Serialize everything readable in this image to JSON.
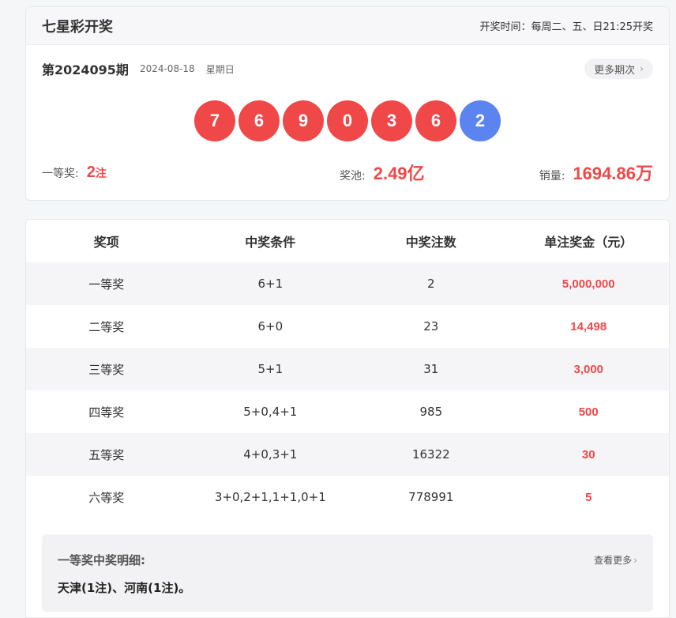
{
  "header": {
    "title": "七星彩开奖",
    "schedule": "开奖时间：每周二、五、日21:25开奖"
  },
  "issue": {
    "number": "第2024095期",
    "date": "2024-08-18",
    "weekday": "星期日",
    "more_label": "更多期次",
    "more_icon": "chevron-right-icon"
  },
  "balls": {
    "red": [
      "7",
      "6",
      "9",
      "0",
      "3",
      "6"
    ],
    "blue": [
      "2"
    ],
    "colors": {
      "red": "#f04848",
      "blue": "#5b84f0"
    }
  },
  "stats": {
    "first_prize_label": "一等奖:",
    "first_prize_count": "2",
    "first_prize_unit": "注",
    "pool_label": "奖池:",
    "pool_value": "2.49",
    "pool_unit": "亿",
    "sales_label": "销量:",
    "sales_value": "1694.86",
    "sales_unit": "万"
  },
  "table": {
    "headers": [
      "奖项",
      "中奖条件",
      "中奖注数",
      "单注奖金（元）"
    ],
    "rows": [
      [
        "一等奖",
        "6+1",
        "2",
        "5,000,000"
      ],
      [
        "二等奖",
        "6+0",
        "23",
        "14,498"
      ],
      [
        "三等奖",
        "5+1",
        "31",
        "3,000"
      ],
      [
        "四等奖",
        "5+0,4+1",
        "985",
        "500"
      ],
      [
        "五等奖",
        "4+0,3+1",
        "16322",
        "30"
      ],
      [
        "六等奖",
        "3+0,2+1,1+1,0+1",
        "778991",
        "5"
      ]
    ]
  },
  "detail": {
    "title": "一等奖中奖明细:",
    "more_label": "查看更多",
    "content": "天津(1注)、河南(1注)。"
  },
  "accent_color": "#f04848"
}
